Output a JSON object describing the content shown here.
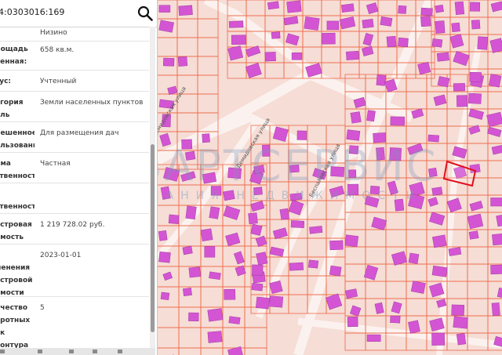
{
  "search": {
    "value": "4:0303016:169"
  },
  "panel": {
    "rows": [
      {
        "label": "",
        "value": "Низино"
      },
      {
        "label": "лощадь\nченная:",
        "value": "658 кв.м."
      },
      {
        "label": "тус:",
        "value": "Учтенный"
      },
      {
        "label": "егория\nель",
        "value": "Земли населенных пунктов"
      },
      {
        "label": "решенное\nользование",
        "value": "Для размещения дач"
      },
      {
        "label": "рма\nственности",
        "value": "Частная"
      },
      {
        "label": "\nственности",
        "value": ""
      },
      {
        "label": "астровая\nимость",
        "value": "1 219 728.02 руб."
      },
      {
        "label": "а\nменения\nастровой\nимости",
        "value": "2023-01-01"
      },
      {
        "label": "ичество\nоротных\nек контура",
        "value": "5"
      }
    ]
  },
  "map": {
    "streets": [
      "Демидовская улица",
      "Беспалевская улица",
      "Демидовская улица"
    ],
    "highlight_color": "#e0101e",
    "building_color": "#d455d4",
    "boundary_color": "#ee6a4a"
  },
  "watermark": {
    "title": "КВАРТСЕРВИС",
    "subtitle": "КОМПАНИЯ НЕДВИЖИМОСТИ"
  }
}
